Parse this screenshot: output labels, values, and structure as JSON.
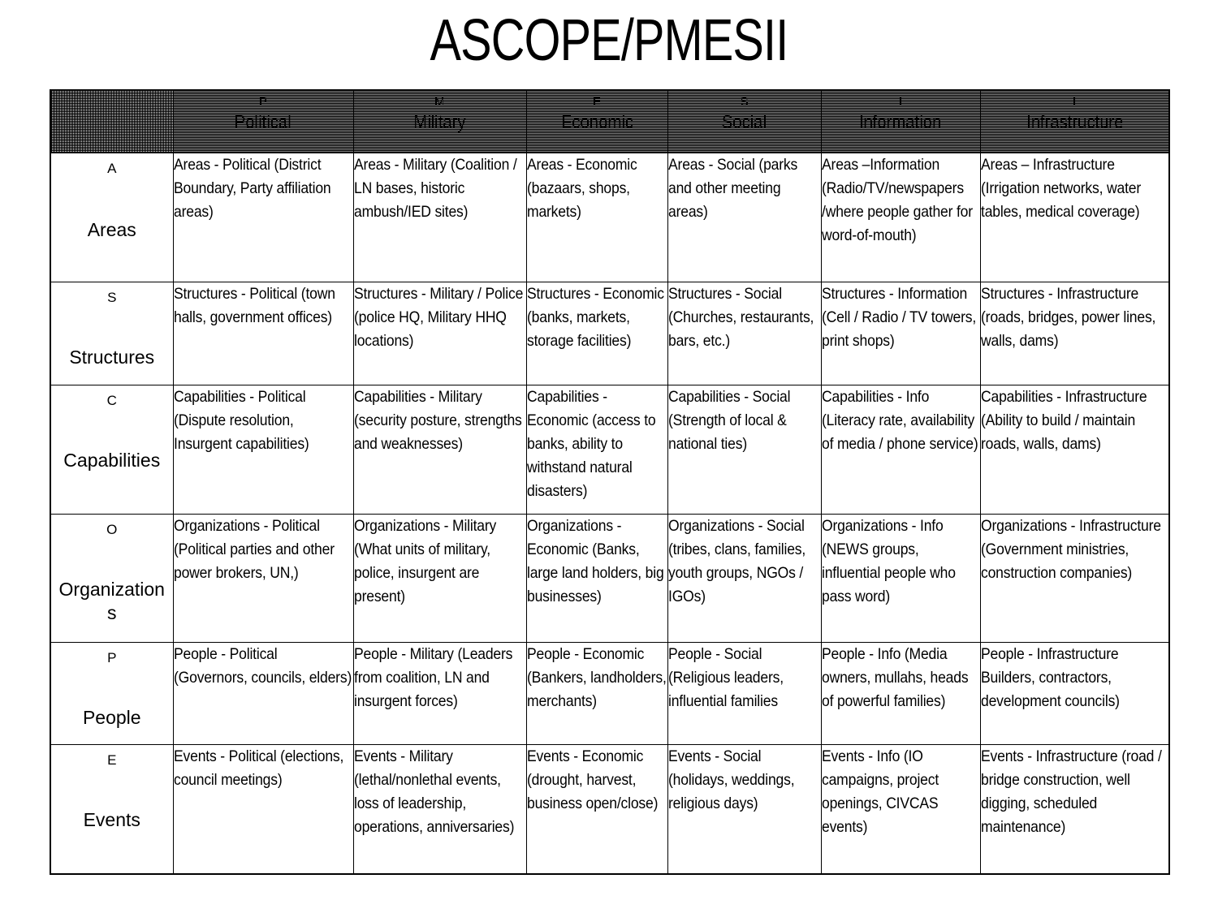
{
  "title": "ASCOPE/PMESII",
  "table": {
    "corner_label": "",
    "columns": [
      {
        "letter": "P",
        "label": "Political"
      },
      {
        "letter": "M",
        "label": "Military"
      },
      {
        "letter": "E",
        "label": "Economic"
      },
      {
        "letter": "S",
        "label": "Social"
      },
      {
        "letter": "I",
        "label": "Information"
      },
      {
        "letter": "I",
        "label": "Infrastructure"
      }
    ],
    "rows": [
      {
        "letter": "A",
        "label": "Areas",
        "cells": [
          "Areas - Political (District Boundary, Party affiliation areas)",
          "Areas - Military (Coalition / LN bases, historic ambush/IED sites)",
          "Areas - Economic (bazaars, shops, markets)",
          "Areas - Social (parks and other meeting areas)",
          "Areas –Information (Radio/TV/newspapers /where people gather for word-of-mouth)",
          "Areas – Infrastructure (Irrigation networks, water tables, medical coverage)"
        ]
      },
      {
        "letter": "S",
        "label": "Structures",
        "cells": [
          "Structures - Political (town halls, government offices)",
          "Structures - Military / Police (police HQ, Military HHQ locations)",
          "Structures - Economic (banks, markets, storage facilities)",
          "Structures - Social (Churches, restaurants, bars, etc.)",
          "Structures - Information (Cell / Radio / TV towers, print shops)",
          "Structures - Infrastructure (roads, bridges, power lines, walls, dams)"
        ]
      },
      {
        "letter": "C",
        "label": "Capabilities",
        "cells": [
          "Capabilities - Political (Dispute resolution, Insurgent capabilities)",
          "Capabilities - Military (security posture, strengths and weaknesses)",
          "Capabilities - Economic (access to banks, ability to withstand natural disasters)",
          "Capabilities - Social (Strength of local & national ties)",
          "Capabilities - Info (Literacy rate, availability of media / phone service)",
          "Capabilities - Infrastructure (Ability to build / maintain roads, walls, dams)"
        ]
      },
      {
        "letter": "O",
        "label": "Organizations",
        "cells": [
          "Organizations - Political (Political parties and other power brokers, UN,)",
          "Organizations - Military (What units of military, police, insurgent are present)",
          "Organizations - Economic (Banks, large land holders, big businesses)",
          "Organizations - Social (tribes, clans, families, youth groups, NGOs / IGOs)",
          "Organizations - Info (NEWS groups, influential people who pass word)",
          "Organizations - Infrastructure (Government ministries, construction companies)"
        ]
      },
      {
        "letter": "P",
        "label": "People",
        "cells": [
          "People - Political (Governors, councils, elders)",
          "People - Military (Leaders from coalition, LN and insurgent forces)",
          "People - Economic (Bankers, landholders, merchants)",
          "People - Social (Religious leaders, influential families",
          "People - Info (Media owners, mullahs, heads of powerful families)",
          "People - Infrastructure Builders, contractors, development councils)"
        ]
      },
      {
        "letter": "E",
        "label": "Events",
        "cells": [
          "Events - Political (elections, council meetings)",
          "Events - Military (lethal/nonlethal events, loss of leadership, operations, anniversaries)",
          "Events - Economic (drought, harvest, business open/close)",
          "Events - Social (holidays, weddings, religious days)",
          "Events - Info (IO campaigns, project openings, CIVCAS events)",
          "Events - Infrastructure (road / bridge construction, well digging, scheduled maintenance)"
        ]
      }
    ]
  }
}
